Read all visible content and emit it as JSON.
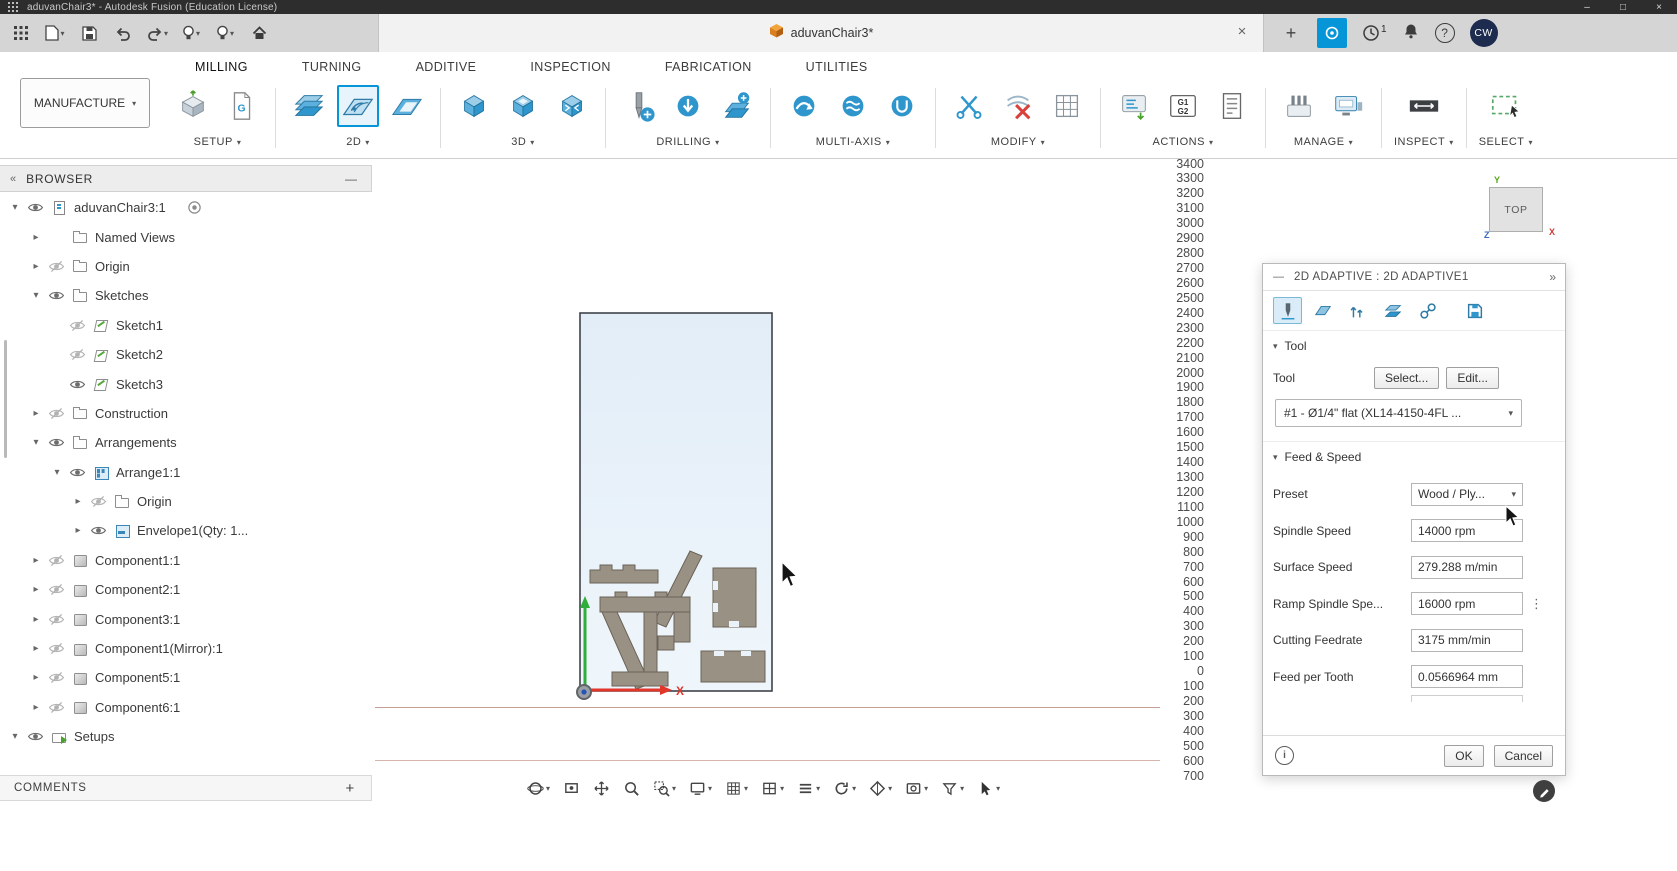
{
  "colors": {
    "accent": "#0696d7",
    "stock_fill": "#e9f1fa",
    "part_fill": "#9a9185",
    "axis_x": "#e2362b",
    "axis_y": "#2fae3b",
    "grid_line": "#c79f92"
  },
  "glyphs": {
    "caret_down": "▾",
    "chevron_right": "▸",
    "double_chevron_left": "«",
    "double_chevron_right": "»",
    "minus": "—",
    "plus": "+",
    "close": "×",
    "help": "?",
    "menu_dots": "⋮",
    "info": "i",
    "window_minimize": "–",
    "window_restore": "□",
    "window_close": "×"
  },
  "titlebar": {
    "title": "aduvanChair3* - Autodesk Fusion (Education License)"
  },
  "qat": {
    "document_tab_title": "aduvanChair3*",
    "jobs_badge": "1",
    "avatar_initials": "CW"
  },
  "ribbon": {
    "manufacture_label": "MANUFACTURE",
    "tabs": [
      {
        "label": "MILLING",
        "active": true
      },
      {
        "label": "TURNING"
      },
      {
        "label": "ADDITIVE"
      },
      {
        "label": "INSPECTION"
      },
      {
        "label": "FABRICATION"
      },
      {
        "label": "UTILITIES"
      }
    ],
    "groups": [
      {
        "label": "SETUP",
        "icons": [
          "setup",
          "gcode-document"
        ]
      },
      {
        "label": "2D",
        "icons": [
          "2d-face",
          "2d-adaptive",
          "2d-pocket"
        ],
        "active_icon": "2d-adaptive"
      },
      {
        "label": "3D",
        "icons": [
          "3d-adaptive",
          "3d-pocket",
          "3d-contour"
        ]
      },
      {
        "label": "DRILLING",
        "icons": [
          "drill",
          "drill-badge",
          "drill-stack"
        ]
      },
      {
        "label": "MULTI-AXIS",
        "icons": [
          "multiaxis-swarf",
          "multiaxis-flow",
          "multiaxis-port"
        ]
      },
      {
        "label": "MODIFY",
        "icons": [
          "trim-toolpath",
          "delete-toolpath",
          "edit-grid"
        ]
      },
      {
        "label": "ACTIONS",
        "icons": [
          "post-process",
          "g1g2",
          "setup-sheet"
        ]
      },
      {
        "label": "MANAGE",
        "icons": [
          "tool-library",
          "machine-library"
        ]
      },
      {
        "label": "INSPECT",
        "icons": [
          "measure"
        ]
      },
      {
        "label": "SELECT",
        "icons": [
          "window-select"
        ]
      }
    ]
  },
  "browser": {
    "title": "BROWSER",
    "comments_label": "COMMENTS",
    "items": [
      {
        "label": "aduvanChair3:1",
        "level": 0,
        "arrow": "down",
        "eye": "on",
        "icon": "document",
        "extra": "target"
      },
      {
        "label": "Named Views",
        "level": 1,
        "arrow": "right",
        "eye": "none",
        "icon": "folder"
      },
      {
        "label": "Origin",
        "level": 1,
        "arrow": "right",
        "eye": "off",
        "icon": "folder"
      },
      {
        "label": "Sketches",
        "level": 1,
        "arrow": "down",
        "eye": "on",
        "icon": "folder"
      },
      {
        "label": "Sketch1",
        "level": 2,
        "arrow": "none",
        "eye": "off",
        "icon": "sketch"
      },
      {
        "label": "Sketch2",
        "level": 2,
        "arrow": "none",
        "eye": "off",
        "icon": "sketch"
      },
      {
        "label": "Sketch3",
        "level": 2,
        "arrow": "none",
        "eye": "on",
        "icon": "sketch"
      },
      {
        "label": "Construction",
        "level": 1,
        "arrow": "right",
        "eye": "off",
        "icon": "folder"
      },
      {
        "label": "Arrangements",
        "level": 1,
        "arrow": "down",
        "eye": "on",
        "icon": "folder"
      },
      {
        "label": "Arrange1:1",
        "level": 2,
        "arrow": "down",
        "eye": "on",
        "icon": "arrange"
      },
      {
        "label": "Origin",
        "level": 3,
        "arrow": "right",
        "eye": "off",
        "icon": "folder"
      },
      {
        "label": "Envelope1(Qty: 1...",
        "level": 3,
        "arrow": "right",
        "eye": "on",
        "icon": "envelope"
      },
      {
        "label": "Component1:1",
        "level": 1,
        "arrow": "right",
        "eye": "off",
        "icon": "component"
      },
      {
        "label": "Component2:1",
        "level": 1,
        "arrow": "right",
        "eye": "off",
        "icon": "component"
      },
      {
        "label": "Component3:1",
        "level": 1,
        "arrow": "right",
        "eye": "off",
        "icon": "component"
      },
      {
        "label": "Component1(Mirror):1",
        "level": 1,
        "arrow": "right",
        "eye": "off",
        "icon": "component"
      },
      {
        "label": "Component5:1",
        "level": 1,
        "arrow": "right",
        "eye": "off",
        "icon": "component"
      },
      {
        "label": "Component6:1",
        "level": 1,
        "arrow": "right",
        "eye": "off",
        "icon": "component"
      },
      {
        "label": "Setups",
        "level": 0,
        "arrow": "down",
        "eye": "on",
        "icon": "setups"
      }
    ]
  },
  "canvas": {
    "ruler_labels": [
      "3400",
      "3300",
      "3200",
      "3100",
      "3000",
      "2900",
      "2800",
      "2700",
      "2600",
      "2500",
      "2400",
      "2300",
      "2200",
      "2100",
      "2000",
      "1900",
      "1800",
      "1700",
      "1600",
      "1500",
      "1400",
      "1300",
      "1200",
      "1100",
      "1000",
      "900",
      "800",
      "700",
      "600",
      "500",
      "400",
      "300",
      "200",
      "100",
      "0",
      "100",
      "200",
      "300",
      "400",
      "500",
      "600",
      "700"
    ],
    "origin_x_label": "X",
    "nav_icons": [
      {
        "name": "orbit",
        "caret": true
      },
      {
        "name": "look-at",
        "caret": false
      },
      {
        "name": "pan",
        "caret": false
      },
      {
        "name": "zoom",
        "caret": false
      },
      {
        "name": "window-zoom",
        "caret": true
      },
      {
        "name": "display-settings",
        "caret": true
      },
      {
        "name": "grid-snaps",
        "caret": true
      },
      {
        "name": "viewports",
        "caret": true
      },
      {
        "name": "layers",
        "caret": true
      },
      {
        "name": "refresh",
        "caret": true
      },
      {
        "name": "shading",
        "caret": true
      },
      {
        "name": "capture",
        "caret": true
      },
      {
        "name": "selection-filter",
        "caret": true
      },
      {
        "name": "select-tool",
        "caret": true
      }
    ]
  },
  "viewcube": {
    "face_label": "TOP",
    "axis_x": "X",
    "axis_y": "Y",
    "axis_z": "Z"
  },
  "dialog": {
    "title": "2D ADAPTIVE : 2D ADAPTIVE1",
    "tabs": [
      {
        "name": "tool",
        "active": true
      },
      {
        "name": "geometry"
      },
      {
        "name": "heights"
      },
      {
        "name": "passes"
      },
      {
        "name": "linking"
      },
      {
        "name": "preset",
        "separated": true
      }
    ],
    "tool_section": {
      "header": "Tool",
      "tool_label": "Tool",
      "select_button": "Select...",
      "edit_button": "Edit...",
      "tool_value": "#1 - Ø1/4\" flat (XL14-4150-4FL ..."
    },
    "feed_speed": {
      "header": "Feed & Speed",
      "rows": [
        {
          "label": "Preset",
          "value": "Wood / Ply...",
          "dropdown": true
        },
        {
          "label": "Spindle Speed",
          "value": "14000 rpm"
        },
        {
          "label": "Surface Speed",
          "value": "279.288 m/min"
        },
        {
          "label": "Ramp Spindle Spe...",
          "value": "16000 rpm",
          "menu": true
        },
        {
          "label": "Cutting Feedrate",
          "value": "3175 mm/min"
        },
        {
          "label": "Feed per Tooth",
          "value": "0.0566964 mm"
        }
      ]
    },
    "ok_button": "OK",
    "cancel_button": "Cancel"
  }
}
